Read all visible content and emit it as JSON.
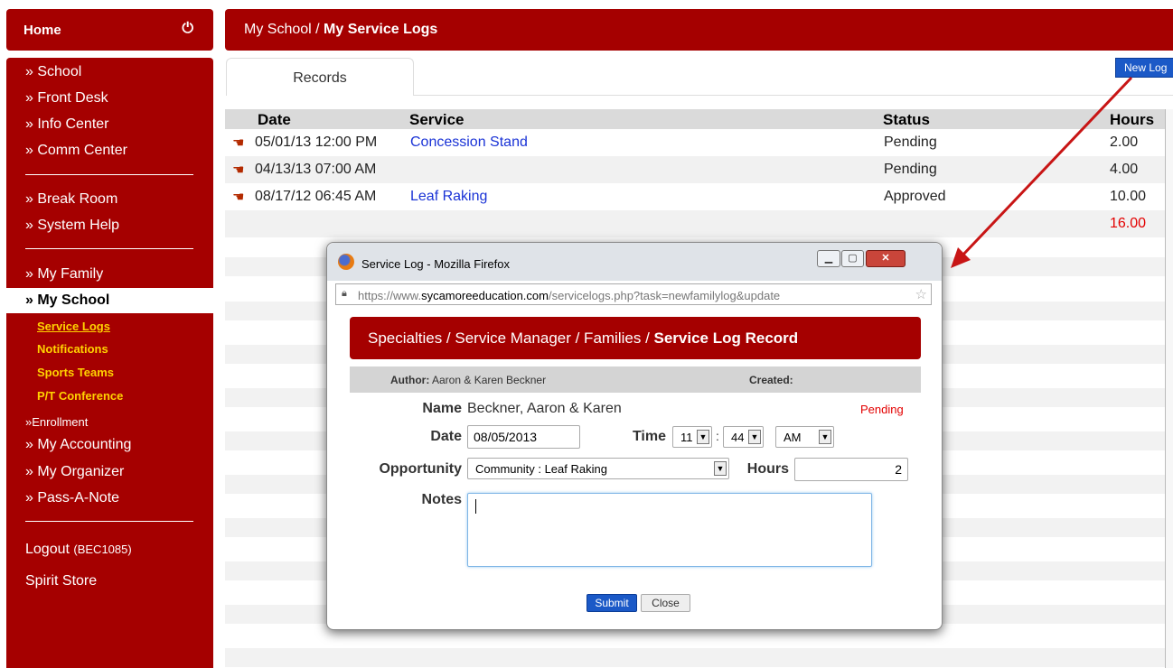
{
  "sidebar": {
    "home_label": "Home",
    "items": {
      "school": "» School",
      "front_desk": "» Front Desk",
      "info_center": "» Info Center",
      "comm_center": "» Comm Center",
      "break_room": "» Break Room",
      "system_help": "» System Help",
      "my_family": "» My Family",
      "my_school": "» My School",
      "service_logs": "Service Logs",
      "notifications": "Notifications",
      "sports_teams": "Sports Teams",
      "pt_conference": "P/T Conference",
      "enrollment": "»Enrollment",
      "my_accounting": "» My Accounting",
      "my_organizer": "» My Organizer",
      "pass_a_note": "» Pass-A-Note",
      "logout": "Logout",
      "user_code": "(BEC1085)",
      "spirit_store": "Spirit Store"
    }
  },
  "header": {
    "crumb_parent": "My School / ",
    "crumb_current": "My Service Logs"
  },
  "tabs": {
    "records": "Records"
  },
  "new_log_label": "New Log",
  "table": {
    "headers": {
      "date": "Date",
      "service": "Service",
      "status": "Status",
      "hours": "Hours"
    },
    "rows": [
      {
        "date": "05/01/13 12:00 PM",
        "service": "Concession Stand",
        "status": "Pending",
        "hours": "2.00"
      },
      {
        "date": "04/13/13 07:00 AM",
        "service": "",
        "status": "Pending",
        "hours": "4.00"
      },
      {
        "date": "08/17/12 06:45 AM",
        "service": "Leaf Raking",
        "status": "Approved",
        "hours": "10.00"
      }
    ],
    "total_hours": "16.00"
  },
  "popup": {
    "window_title": "Service Log - Mozilla Firefox",
    "url_prefix": "https://www.",
    "url_domain": "sycamoreeducation.com",
    "url_path": "/servicelogs.php?task=newfamilylog&update",
    "crumb_parent": "Specialties / Service Manager / Families / ",
    "crumb_current": "Service Log Record",
    "author_label": "Author:",
    "author_value": "Aaron & Karen Beckner",
    "created_label": "Created:",
    "name_label": "Name",
    "name_value": "Beckner, Aaron & Karen",
    "status_value": "Pending",
    "date_label": "Date",
    "date_value": "08/05/2013",
    "time_label": "Time",
    "hour_value": "11",
    "minute_value": "44",
    "ampm_value": "AM",
    "opportunity_label": "Opportunity",
    "opportunity_value": "Community : Leaf Raking",
    "hours_label": "Hours",
    "hours_value": "2",
    "notes_label": "Notes",
    "submit_label": "Submit",
    "close_label": "Close"
  },
  "colors": {
    "brand_red": "#a50000",
    "link_blue": "#1a33d6",
    "accent_yellow": "#ffd200",
    "total_red": "#e30000",
    "button_blue": "#1b59c7"
  }
}
